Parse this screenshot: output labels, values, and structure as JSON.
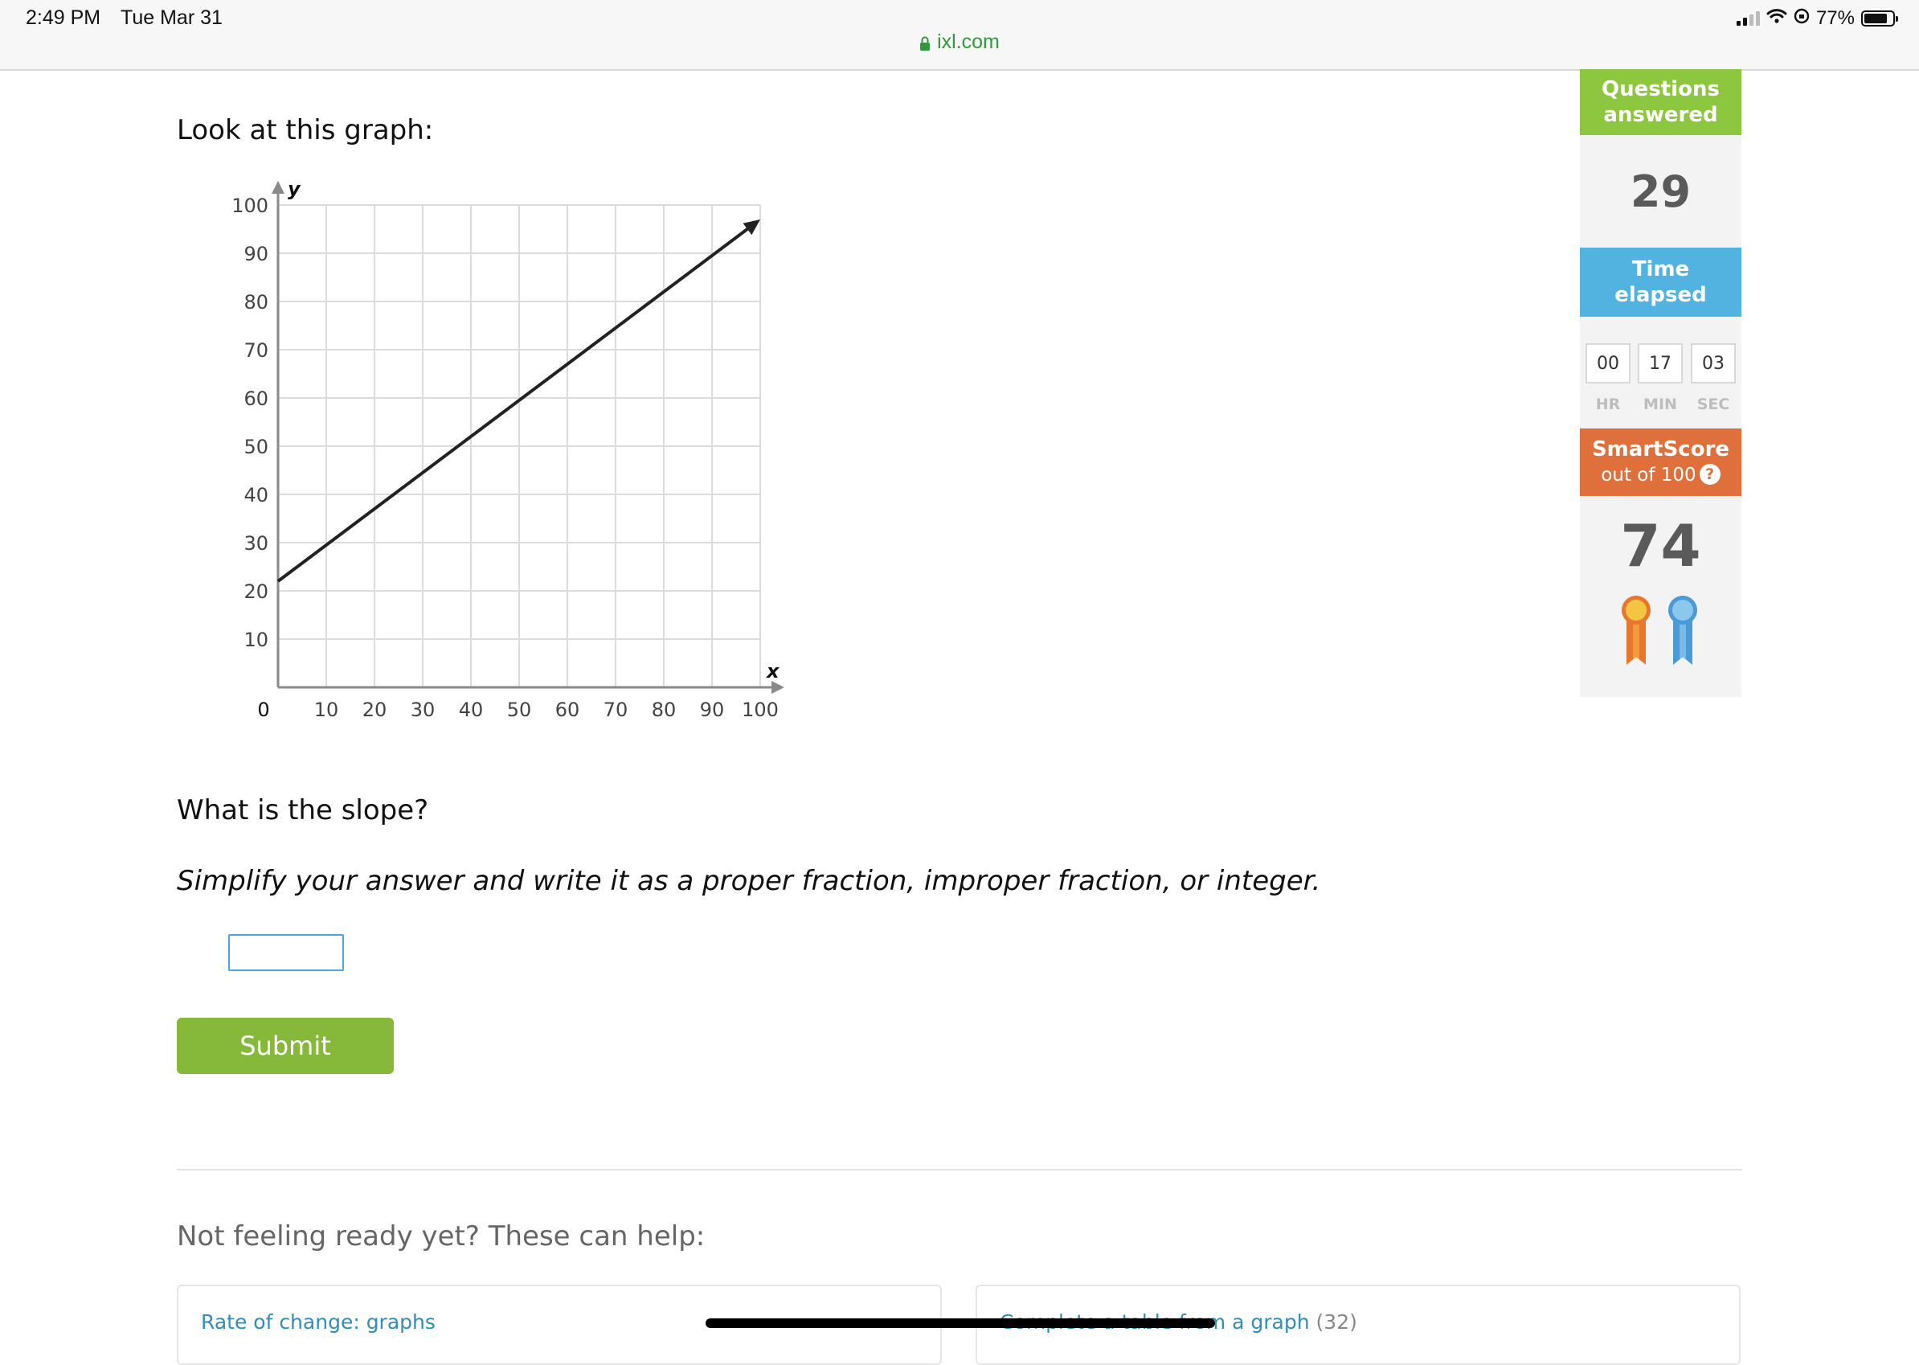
{
  "status_bar": {
    "time": "2:49 PM",
    "date": "Tue Mar 31",
    "battery": "77%"
  },
  "address_bar": {
    "url": "ixl.com"
  },
  "question": {
    "prompt": "Look at this graph:",
    "question_text": "What is the slope?",
    "instruction": "Simplify your answer and write it as a proper fraction, improper fraction, or integer.",
    "answer_value": "",
    "submit_label": "Submit"
  },
  "chart_data": {
    "type": "line",
    "xlabel": "x",
    "ylabel": "y",
    "xlim": [
      0,
      100
    ],
    "ylim": [
      0,
      100
    ],
    "x_ticks": [
      "10",
      "20",
      "30",
      "40",
      "50",
      "60",
      "70",
      "80",
      "90",
      "100"
    ],
    "y_ticks": [
      "10",
      "20",
      "30",
      "40",
      "50",
      "60",
      "70",
      "80",
      "90",
      "100"
    ],
    "origin_label": "0",
    "grid": true,
    "series": [
      {
        "x": [
          0,
          100
        ],
        "y": [
          22,
          97
        ],
        "arrow_end": true
      }
    ]
  },
  "sidebar": {
    "questions_answered_label": "Questions answered",
    "questions_answered_line1": "Questions",
    "questions_answered_line2": "answered",
    "questions_answered_value": "29",
    "time_elapsed_line1": "Time",
    "time_elapsed_line2": "elapsed",
    "time": {
      "hr": "00",
      "min": "17",
      "sec": "03"
    },
    "time_units": {
      "hr": "HR",
      "min": "MIN",
      "sec": "SEC"
    },
    "smartscore_label": "SmartScore",
    "smartscore_sub": "out of 100",
    "smartscore_help": "?",
    "smartscore_value": "74",
    "ribbon_colors": [
      "#e8772e",
      "#4a9ad8"
    ]
  },
  "help": {
    "heading": "Not feeling ready yet? These can help:",
    "cards": [
      {
        "title": "Rate of change: graphs",
        "count": ""
      },
      {
        "title": "Complete a table from a graph",
        "count": "(32)"
      }
    ]
  }
}
